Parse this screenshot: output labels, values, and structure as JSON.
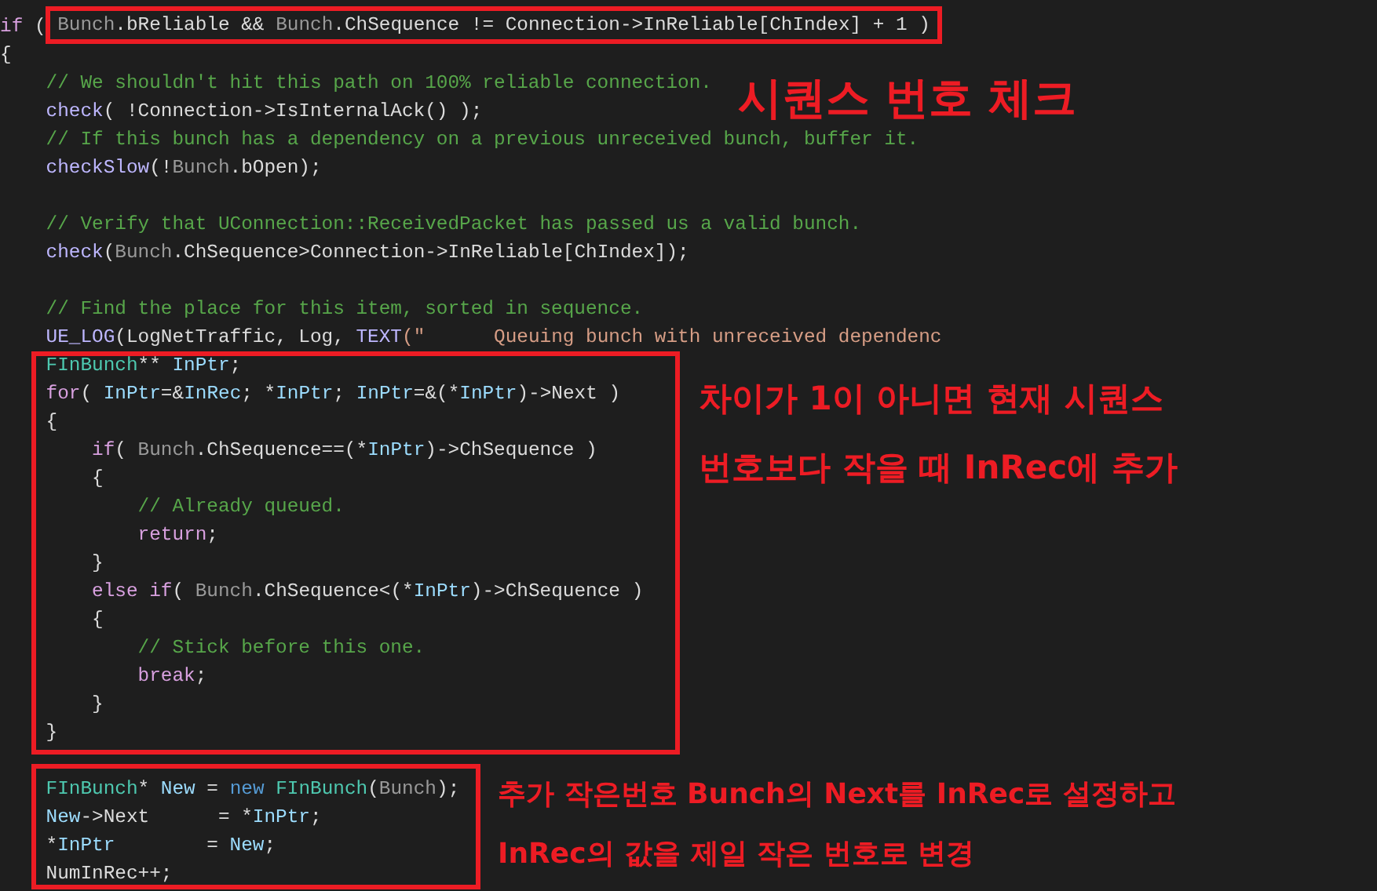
{
  "code_lines": [
    {
      "kind": "framed",
      "lead": [
        {
          "kind": "keyword",
          "text": "if"
        },
        {
          "kind": "plain",
          "text": " ( "
        }
      ],
      "tokens": [
        {
          "kind": "param",
          "text": "Bunch"
        },
        {
          "kind": "plain",
          "text": ".bReliable && "
        },
        {
          "kind": "param",
          "text": "Bunch"
        },
        {
          "kind": "plain",
          "text": ".ChSequence != Connection->InReliable[ChIndex] + 1 )"
        }
      ]
    },
    {
      "kind": "code",
      "tokens": [
        {
          "kind": "plain",
          "text": "{"
        }
      ]
    },
    {
      "kind": "code",
      "tokens": [
        {
          "kind": "comment",
          "text": "    // We shouldn't hit this path on 100% reliable connection."
        }
      ]
    },
    {
      "kind": "code",
      "tokens": [
        {
          "kind": "macro",
          "text": "    check"
        },
        {
          "kind": "plain",
          "text": "( !Connection->IsInternalAck() );"
        }
      ]
    },
    {
      "kind": "code",
      "tokens": [
        {
          "kind": "comment",
          "text": "    // If this bunch has a dependency on a previous unreceived bunch, buffer it."
        }
      ]
    },
    {
      "kind": "code",
      "tokens": [
        {
          "kind": "macro",
          "text": "    checkSlow"
        },
        {
          "kind": "plain",
          "text": "(!"
        },
        {
          "kind": "param",
          "text": "Bunch"
        },
        {
          "kind": "plain",
          "text": ".bOpen);"
        }
      ]
    },
    {
      "kind": "blank"
    },
    {
      "kind": "code",
      "tokens": [
        {
          "kind": "comment",
          "text": "    // Verify that UConnection::ReceivedPacket has passed us a valid bunch."
        }
      ]
    },
    {
      "kind": "code",
      "tokens": [
        {
          "kind": "macro",
          "text": "    check"
        },
        {
          "kind": "plain",
          "text": "("
        },
        {
          "kind": "param",
          "text": "Bunch"
        },
        {
          "kind": "plain",
          "text": ".ChSequence>Connection->InReliable[ChIndex]);"
        }
      ]
    },
    {
      "kind": "blank"
    },
    {
      "kind": "code",
      "tokens": [
        {
          "kind": "comment",
          "text": "    // Find the place for this item, sorted in sequence."
        }
      ]
    },
    {
      "kind": "code",
      "tokens": [
        {
          "kind": "macro",
          "text": "    UE_LOG"
        },
        {
          "kind": "plain",
          "text": "(LogNetTraffic, Log, "
        },
        {
          "kind": "macro",
          "text": "TEXT"
        },
        {
          "kind": "string",
          "text": "(\"      Queuing bunch with unreceived dependenc"
        }
      ]
    },
    {
      "kind": "code",
      "tokens": [
        {
          "kind": "type",
          "text": "    FInBunch"
        },
        {
          "kind": "plain",
          "text": "** "
        },
        {
          "kind": "var",
          "text": "InPtr"
        },
        {
          "kind": "plain",
          "text": ";"
        }
      ]
    },
    {
      "kind": "code",
      "tokens": [
        {
          "kind": "keyword",
          "text": "    for"
        },
        {
          "kind": "plain",
          "text": "( "
        },
        {
          "kind": "var",
          "text": "InPtr"
        },
        {
          "kind": "plain",
          "text": "=&"
        },
        {
          "kind": "var",
          "text": "InRec"
        },
        {
          "kind": "plain",
          "text": "; *"
        },
        {
          "kind": "var",
          "text": "InPtr"
        },
        {
          "kind": "plain",
          "text": "; "
        },
        {
          "kind": "var",
          "text": "InPtr"
        },
        {
          "kind": "plain",
          "text": "=&(*"
        },
        {
          "kind": "var",
          "text": "InPtr"
        },
        {
          "kind": "plain",
          "text": ")->Next )"
        }
      ]
    },
    {
      "kind": "code",
      "tokens": [
        {
          "kind": "plain",
          "text": "    {"
        }
      ]
    },
    {
      "kind": "code",
      "tokens": [
        {
          "kind": "keyword",
          "text": "        if"
        },
        {
          "kind": "plain",
          "text": "( "
        },
        {
          "kind": "param",
          "text": "Bunch"
        },
        {
          "kind": "plain",
          "text": ".ChSequence==(*"
        },
        {
          "kind": "var",
          "text": "InPtr"
        },
        {
          "kind": "plain",
          "text": ")->ChSequence )"
        }
      ]
    },
    {
      "kind": "code",
      "tokens": [
        {
          "kind": "plain",
          "text": "        {"
        }
      ]
    },
    {
      "kind": "code",
      "tokens": [
        {
          "kind": "comment",
          "text": "            // Already queued."
        }
      ]
    },
    {
      "kind": "code",
      "tokens": [
        {
          "kind": "keyword",
          "text": "            return"
        },
        {
          "kind": "plain",
          "text": ";"
        }
      ]
    },
    {
      "kind": "code",
      "tokens": [
        {
          "kind": "plain",
          "text": "        }"
        }
      ]
    },
    {
      "kind": "code",
      "tokens": [
        {
          "kind": "keyword",
          "text": "        else if"
        },
        {
          "kind": "plain",
          "text": "( "
        },
        {
          "kind": "param",
          "text": "Bunch"
        },
        {
          "kind": "plain",
          "text": ".ChSequence<(*"
        },
        {
          "kind": "var",
          "text": "InPtr"
        },
        {
          "kind": "plain",
          "text": ")->ChSequence )"
        }
      ]
    },
    {
      "kind": "code",
      "tokens": [
        {
          "kind": "plain",
          "text": "        {"
        }
      ]
    },
    {
      "kind": "code",
      "tokens": [
        {
          "kind": "comment",
          "text": "            // Stick before this one."
        }
      ]
    },
    {
      "kind": "code",
      "tokens": [
        {
          "kind": "keyword",
          "text": "            break"
        },
        {
          "kind": "plain",
          "text": ";"
        }
      ]
    },
    {
      "kind": "code",
      "tokens": [
        {
          "kind": "plain",
          "text": "        }"
        }
      ]
    },
    {
      "kind": "code",
      "tokens": [
        {
          "kind": "plain",
          "text": "    }"
        }
      ]
    },
    {
      "kind": "blank"
    },
    {
      "kind": "code",
      "tokens": [
        {
          "kind": "type",
          "text": "    FInBunch"
        },
        {
          "kind": "plain",
          "text": "* "
        },
        {
          "kind": "var",
          "text": "New"
        },
        {
          "kind": "plain",
          "text": " = "
        },
        {
          "kind": "new",
          "text": "new"
        },
        {
          "kind": "type",
          "text": " FInBunch"
        },
        {
          "kind": "plain",
          "text": "("
        },
        {
          "kind": "param",
          "text": "Bunch"
        },
        {
          "kind": "plain",
          "text": ");"
        }
      ]
    },
    {
      "kind": "code",
      "tokens": [
        {
          "kind": "var",
          "text": "    New"
        },
        {
          "kind": "plain",
          "text": "->Next      = *"
        },
        {
          "kind": "var",
          "text": "InPtr"
        },
        {
          "kind": "plain",
          "text": ";"
        }
      ]
    },
    {
      "kind": "code",
      "tokens": [
        {
          "kind": "plain",
          "text": "    *"
        },
        {
          "kind": "var",
          "text": "InPtr"
        },
        {
          "kind": "plain",
          "text": "        = "
        },
        {
          "kind": "var",
          "text": "New"
        },
        {
          "kind": "plain",
          "text": ";"
        }
      ]
    },
    {
      "kind": "code",
      "tokens": [
        {
          "kind": "plain",
          "text": "    NumInRec++;"
        }
      ]
    }
  ],
  "annotations": [
    {
      "lines": [
        "시퀀스 번호 체크"
      ]
    },
    {
      "lines": [
        "차이가 1이 아니면 현재 시퀀스",
        "번호보다 작을 때 InRec에 추가"
      ]
    },
    {
      "lines": [
        "추가 작은번호 Bunch의 Next를 InRec로 설정하고",
        "InRec의 값을 제일 작은 번호로 변경"
      ]
    }
  ]
}
